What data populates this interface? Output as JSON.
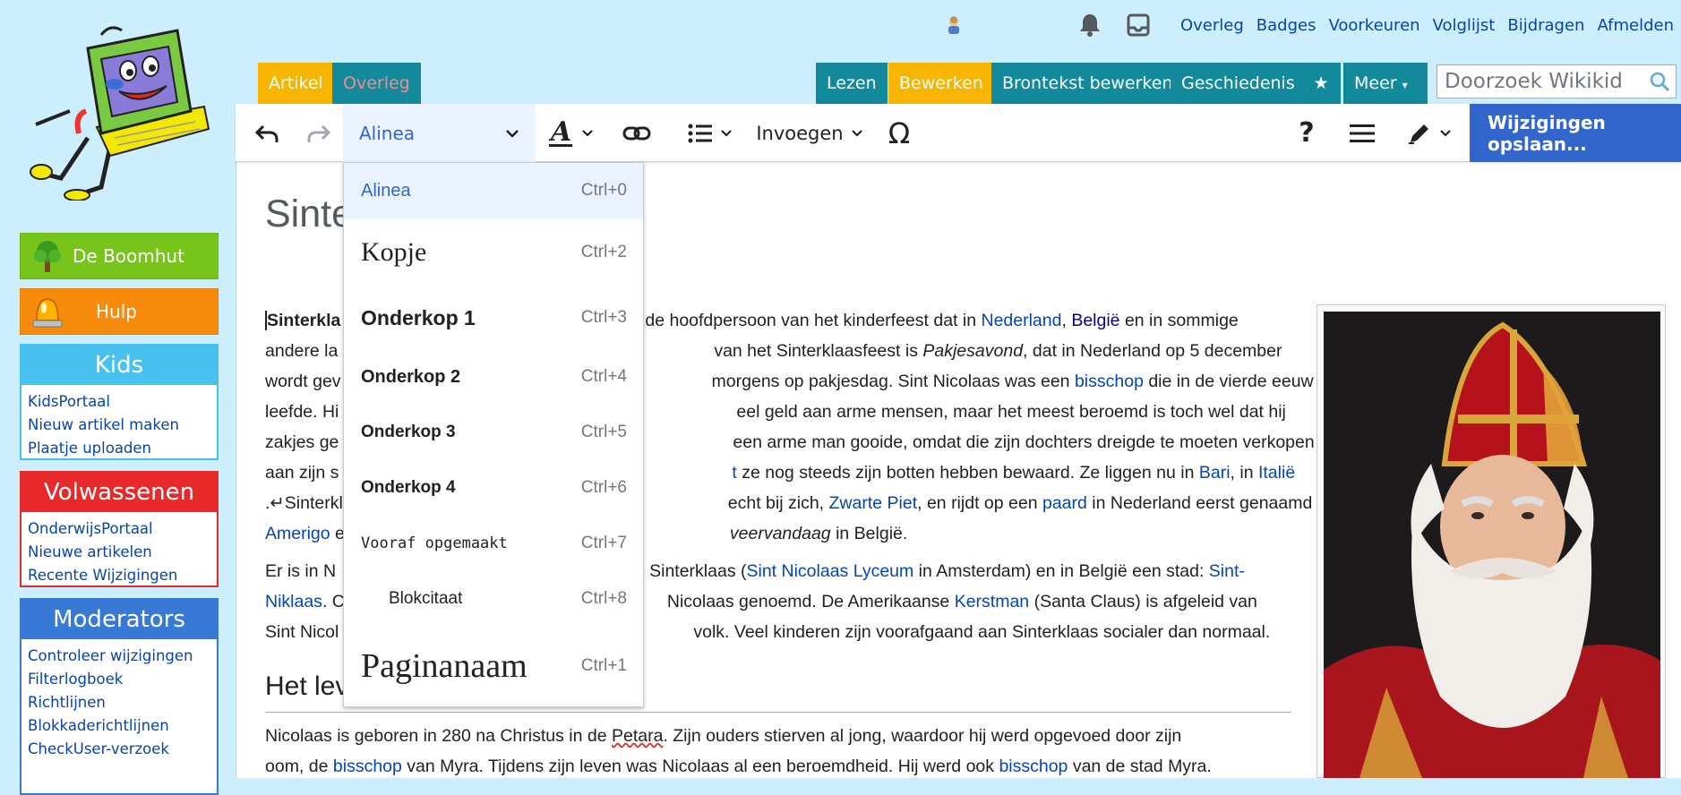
{
  "personal": {
    "links": [
      "Overleg",
      "Badges",
      "Voorkeuren",
      "Volglijst",
      "Bijdragen",
      "Afmelden"
    ],
    "icons": [
      "user-icon",
      "bell-icon",
      "inbox-icon"
    ]
  },
  "sidebar": {
    "boomhut": "De Boomhut",
    "hulp": "Hulp",
    "kids": {
      "title": "Kids",
      "items": [
        "KidsPortaal",
        "Nieuw artikel maken",
        "Plaatje uploaden"
      ]
    },
    "volwassenen": {
      "title": "Volwassenen",
      "items": [
        "OnderwijsPortaal",
        "Nieuwe artikelen",
        "Recente Wijzigingen"
      ]
    },
    "moderators": {
      "title": "Moderators",
      "items": [
        "Controleer wijzigingen",
        "Filterlogboek",
        "Richtlijnen",
        "Blokkaderichtlijnen",
        "CheckUser-verzoek"
      ]
    }
  },
  "tabs": {
    "left": [
      "Artikel",
      "Overleg"
    ],
    "right": [
      "Lezen",
      "Bewerken",
      "Brontekst bewerken",
      "Geschiedenis"
    ],
    "more": "Meer",
    "search_placeholder": "Doorzoek Wikikid"
  },
  "toolbar": {
    "format_value": "Alinea",
    "insert_label": "Invoegen",
    "save_label": "Wijzigingen opslaan..."
  },
  "format_menu": [
    {
      "label": "Alinea",
      "shortcut": "Ctrl+0"
    },
    {
      "label": "Kopje",
      "shortcut": "Ctrl+2"
    },
    {
      "label": "Onderkop 1",
      "shortcut": "Ctrl+3"
    },
    {
      "label": "Onderkop 2",
      "shortcut": "Ctrl+4"
    },
    {
      "label": "Onderkop 3",
      "shortcut": "Ctrl+5"
    },
    {
      "label": "Onderkop 4",
      "shortcut": "Ctrl+6"
    },
    {
      "label": "Vooraf opgemaakt",
      "shortcut": "Ctrl+7"
    },
    {
      "label": "Blokcitaat",
      "shortcut": "Ctrl+8"
    },
    {
      "label": "Paginanaam",
      "shortcut": "Ctrl+1"
    }
  ],
  "article": {
    "title": "Sinte",
    "p1": {
      "l1a": "Sinterkla",
      "l1b": "de hoofdpersoon van het kinderfeest dat in ",
      "l1c": "Nederland",
      "l1d": ", ",
      "l1e": "België",
      "l1f": " en in sommige",
      "l2a": "andere la",
      "l2b": "van het Sinterklaasfeest is ",
      "l2c": "Pakjesavond",
      "l2d": ", dat in Nederland op 5 december",
      "l3a": "wordt gev",
      "l3b": "morgens op pakjesdag. Sint Nicolaas was een ",
      "l3c": "bisschop",
      "l3d": " die in de vierde eeuw",
      "l4a": "leefde. Hi",
      "l4b": "eel geld aan arme mensen, maar het meest beroemd is toch wel dat hij",
      "l5a": "zakjes ge",
      "l5b": "een arme man gooide, omdat die zijn dochters dreigde te moeten verkopen",
      "l6a": "aan zijn s",
      "l6b": "t",
      "l6c": " ze nog steeds zijn botten hebben bewaard. Ze liggen nu in ",
      "l6d": "Bari",
      "l6e": ", in ",
      "l6f": "Italië",
      "l7a": ".↵Sinterkl",
      "l7b": "echt bij zich, ",
      "l7c": "Zwarte Piet",
      "l7d": ", en rijdt op een ",
      "l7e": "paard",
      "l7f": " in Nederland eerst genaamd",
      "l8a": "Amerigo",
      "l8b": " e",
      "l8c": "veervandaag",
      "l8d": " in België."
    },
    "p2": {
      "l1a": "Er is in N",
      "l1b": "Sinterklaas (",
      "l1c": "Sint Nicolaas Lyceum",
      "l1d": " in Amsterdam) en in België een stad: ",
      "l1e": "Sint-",
      "l2a": "Niklaas",
      "l2b": ". C",
      "l2c": "Nicolaas genoemd. De Amerikaanse ",
      "l2d": "Kerstman",
      "l2e": " (Santa Claus) is afgeleid van",
      "l3a": "Sint Nicol",
      "l3b": "volk. Veel kinderen zijn voorafgaand aan Sinterklaas socialer dan normaal."
    },
    "h2": "Het lev",
    "p3": {
      "l1a": "Nicolaas is geboren in 280 na Christus in de ",
      "l1b": "Petara",
      "l1c": ". Zijn ouders stierven al jong, waardoor hij werd opgevoed door zijn",
      "l2a": "oom, de ",
      "l2b": "bisschop",
      "l2c": " van Myra. Tijdens zijn leven was Nicolaas al een beroemdheid. Hij werd ook ",
      "l2d": "bisschop",
      "l2e": " van de stad Myra."
    }
  },
  "colors": {
    "bg": "#cdeefc",
    "tab_orange": "#f7b500",
    "tab_teal": "#138a9c",
    "boomhut": "#77c51a",
    "hulp": "#f78b0b",
    "kids": "#49c1ee",
    "volwassenen": "#e7292c",
    "moderators": "#3779d4",
    "save": "#3366cc"
  }
}
